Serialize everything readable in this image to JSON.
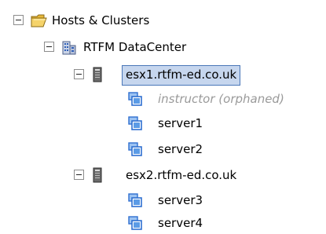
{
  "tree": {
    "root": {
      "label": "Hosts & Clusters",
      "icon": "folder-icon",
      "expanded": true
    },
    "datacenter": {
      "label": "RTFM DataCenter",
      "icon": "datacenter-icon",
      "expanded": true
    },
    "hosts": [
      {
        "label": "esx1.rtfm-ed.co.uk",
        "icon": "host-server-icon",
        "expanded": true,
        "selected": true,
        "vms": [
          {
            "label": "instructor (orphaned)",
            "icon": "vm-icon",
            "orphaned": true
          },
          {
            "label": "server1",
            "icon": "vm-icon"
          },
          {
            "label": "server2",
            "icon": "vm-icon"
          }
        ]
      },
      {
        "label": "esx2.rtfm-ed.co.uk",
        "icon": "host-server-icon",
        "expanded": true,
        "selected": false,
        "vms": [
          {
            "label": "server3",
            "icon": "vm-icon"
          },
          {
            "label": "server4",
            "icon": "vm-icon"
          }
        ]
      }
    ]
  },
  "colors": {
    "selection_background": "#c6d6ee",
    "selection_border": "#4a76b8",
    "orphaned_text": "#9a9a9a",
    "vm_icon_blue": "#2f6fd0"
  }
}
